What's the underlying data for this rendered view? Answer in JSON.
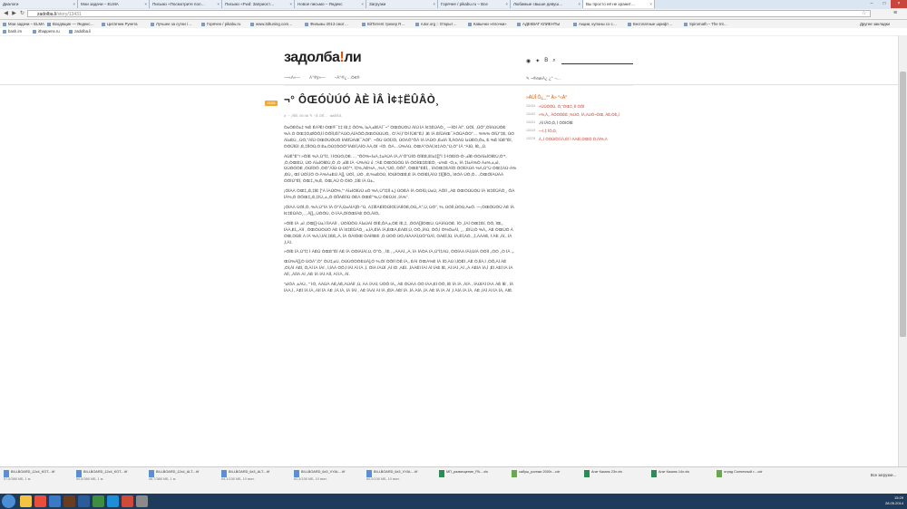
{
  "browser": {
    "tabs": [
      {
        "label": "Диалоги"
      },
      {
        "label": "Мои задачи – ELMA"
      },
      {
        "label": "Письмо «Посмотрите пол…"
      },
      {
        "label": "Письмо «Fwd: Заприост…"
      },
      {
        "label": "Новое письмо – Яндекс"
      },
      {
        "label": "Загрузки"
      },
      {
        "label": "Горячее / pikabu.ru – Все"
      },
      {
        "label": "Любимые свыше девуш…"
      },
      {
        "label": "Вы просто её не хранит…"
      }
    ],
    "url_host": "zadolba.li",
    "url_path": "/story/13431",
    "bookmarks": [
      {
        "label": "Мои задачи – ELMA"
      },
      {
        "label": "Входящие — Яндекс…"
      },
      {
        "label": "Цитатник Рунета"
      },
      {
        "label": "Лучшее за сутки /…"
      },
      {
        "label": "Горячее / pikabu.ru"
      },
      {
        "label": "www.3dtuning.com…"
      },
      {
        "label": "Фильмы 2013 смот…"
      },
      {
        "label": "BitTorrent трекер R…"
      },
      {
        "label": "rutor.org :: Открыт…"
      },
      {
        "label": "Кавычки «ёлочки»"
      },
      {
        "label": "АДЕКВАТ КЛИЕНТЫ"
      },
      {
        "label": "Акции, купоны со с…"
      },
      {
        "label": "Бесплатные шрифт…"
      },
      {
        "label": "Spiromath – The Int…"
      },
      {
        "label": "Другие закладки"
      }
    ],
    "bookmarks2": [
      {
        "label": "bash.im"
      },
      {
        "label": "ithappens.ru"
      },
      {
        "label": "zadolba.li"
      }
    ]
  },
  "site": {
    "logo_main": "задолба",
    "logo_accent": "!",
    "logo_tail": "ли",
    "nav": [
      "–~«Â»—",
      "Â°®ÿ»—",
      "–Â°®¿…Ô€®"
    ],
    "sidebar_header": "✎ ~®ëæÂ¿ ¿° ¬…",
    "badge": "13431",
    "title": "¬° ÔŒÓÙÚÓ ÀÈ ÌÂ Ì¢‡ËÛÂÒ¸",
    "meta": "≠ ···‚‚ÑÑ, 09:46     ✎     ~Ã ÒÊ… ·ààÈÈÁ",
    "paragraphs": [
      "Ò±ÔÈÒ±‡ %Ê ÊÀ³Ê! ÒŒ®¯‡‡ ÍÈ‚‡ ÔÒ%‚ Ì±À‚±ÌÉÀÍ¯~° ÒŒÓÙÒÚ ÀÍÚ ÌÀ Ì¢‡ËÛÂÒ¸, —ÍÒÍ ÀÍ°, ÙÖÌ, ‚ÛÔ°‚ÒÏÀÚÙÒÈ %À.Ò ÒŒ‡Ó‚ØÔÔ‚ÌÍ ÒÔÎÍ,ÊÍ°ÀÙÒ‚ÀÏÀÔÔ‚ÒŒÓÙÚÙÒ‚. ÒˆÀÍ,ÍˆÒÍ ÎÛÈ°Ê‚Ì ‚ÌÈ ÍÀ ÈÏÛÀŒ¯ÀÓÛÀÔÒ°… %%% ÓÏÙ°‡È‚ ÙÓ Àì±ÈÙ, ‚ÙÓ‚°ÀÏÙ ÒŒÓÙÒÚÓ ÍÀÈÏÛÀŒ¯ÀÓÏ°. ~ÔÙ ÙÓÏ‚ÍÒ, ÙÓÀÔ°ÔÂ ÍÀ ÌÀÛÒ ‚È±ÍÀ ÏÍ‚ÃÓÀÙ Ì±ÙÈÒ‚Ò±‚ È %Ê ÌÛÈ°ÊÍ, ÒÓÛÏÛÌ ‚É‚‡ÍÌÒÛ‚Ò È±‚ÒÙ‡ÒÓÔ°ÍÀÈÍÍ‚ÀÍÒ ÀÀ‚ÒÍ ÷ÍÓ. ÒÀ…Û%ÀÙ, ÒŒÀ°ÒÀÍ‚Ì¢‡ÀÒ‚°Ù,Ò° ÌÂ “ÀÌÛ, ÌÈ‚,‚Û.",
      "ÀÛÊ°Ê°! »ÔÍÈ %À,Ù°Ì‡, Ì ÌÒÙÓ‚ÒÈ…, “ÔÒ%«Ì±À,‡±ÀÙÀ ÍÀ,ÀˆÔ°ÙÍÒ ÒÏÈÈ,ÈÌ±‡[]°Ì ‡-ÌÒÈÌÒ-Ò-‚±ÏÈ-ÒÒÀÌ±ÍÒÌÈÙ,Ò’*, ‚Ò,ÒŒÈÙ, ÙÓ Àì±ÍÒÌÈÙ,Ò ‚Ò ‚±ÏÈ ÍÀ -Ù%ÀÚ ó ‚″ÀÈ ÒŒÓÙÒÚ ÍÀ ÒÓÍŒ‡ÈÍÈÒ, -±%È -Ò,±, ÍÀ ‡Ì±À%Ò À±%,±‚±Ì, ÙÙÓÒÒÈ ‚ÒÙÏÒÔ ‚ÒÓ°ÀÏÙ-Ù-ÙÓ°*‚ Ì‡%,ÀÈ%À, ‚%À,”ÙÓ, ÒÔÍ°, ÒŒÈ°ÈÊÍ‚ ‚ ÌÀÓŒ‡ÈÀÏÒ ÒÓÌÍÀÙÀ %À,Ù°Ù ÓŒ‡ÀÙ-À%‚ÈÙ,‚ ŒÌ ÙÓÏ,ÌÒ Ò-À%À±ÈÙ À[]‚ ÙÓÏ, ‚ÙÓ ‚ È‚%±ÈÒÙ, ÌÒÙÌÒŒÈ‚È ÍÀ ÒÓÌÈÍ‚ÀÌÙ ‡Ì[]ÌÌÒ‚‚ Ì¢ÓÀ ÙÓ,Ò…‚ÒŒÓÌÀÙÀÀ ÓÒÌÙ°ÊÍ, ÒŒ‡‚‚%‚È, ÓŒ‚ÀÛ Ò ÓÌÓ ‚‡ÍÈ ÍÀ Ù±‚.",
      "¡ÓÌÀÀ ÒŒ‡‚‚È‚‡ÍÈ [°À ÌÀÚÓ%‚°’ Àì±ÍÒÌÙÙ ±Ó %À,Ù°Ì‡ÍÌ ±‚) ÙÒÈÀ ÍÀ ÒÓÍÙ,Ù±Ù, ÀÔÌÍ ‚‚ÀÈ ÒŒÓÙÙÒÚ ÍÀ Ì¢‡ËÛÂÒ¸, ÔÀ ÌÂ%‚Ò ÒÔŒ‡‚‚È‚‡ÍÙ‚,±‚‚Ò ÒÏÏÀÈÌÌÙ ÒÈÀ ÒŒÊ°%‚Ù ÒÈÛ‚Ì¢ ‚ÍÀ%°.",
      "¡ÓÌÀÀ ÙÓÌ,Ò, %À,Ù°ÌÀ ÍÀ Ò°Ã‚Ù±ÀÌÀ]Ò-°Ù, À‡ÌÍÌÀÈÏÒÛÌÒÌ‚ÌÀÌÌÒÈ‚ÒÙ‚‚À°‚Ù‚ ÙÓ°‚ %‚ ÙÓÌÌ,ÙÓÙ,À±Ô. —‚ÒŒÓÙÒÚ ÀÈ ÍÀ Ì¢‡ËÛÂÒ¸, ‚ Ã[]‚‚,ÙÓÔÙ, Ò ÍÀÀ‚ÒÍÓŒÍÀÈ ÒÔ‚ÀÍÒ‚.",
      "»ÓÍÈ ÍÀ ‚±Ì ‚ÓŒ[]-Ù±‚Ì ÌÌÁÀÌÍ , ÙÓÍÛÔÙ ÀÍ±ÙÀÍ ÓÌÊ‚ÔÀ‚±‚ÒÈ ÍÈ‚‡‚ ‚ÒÓÀ[]ÍÒŒÙ‚ ÙÀÌÀÙÒÈ. ÌÒ ‚‚ÌÀÍ ÓŒ‡ÈÍ‚ ÒÔ‚ ÌŒ‚‚ ÍÀÀ‚ÈÍ‚,‚ÀÌÌ ‚ ÒŒÓÙÒÚÓ ÀÈ ÍÀ Ì¢‡ËÛÂÒ¸, ±‚ÌÀ‚ÊÌÀ ÍÀ‚ÈŒÀ‚ÈÀÈÍ‚Ù‚ ÒÔ‚‚ÍÀÙ‚ ÒÔ‚Ì Ó%Ò±ÀÌ‚ ¸,, ‚ÊÍÙ‚Ò %À‚‚ ÀÈ ÒŒÙÓ À ÓŒ‚ÒÙÈ À ÍÀ %À‚Ì‚ÌÀÍ‚‡ÈÈ‚‚À‚ ÌÀ ÓÀÍÒŒ ÒÀÍÍŒÈ ‚Ò ÙÓÔ ÙÓ‚ÀÍÀÀÀÏ‚ÙÓ°ÙÀÏ, ÒÀÈÏ‚ÍÙ, ÍÀ‚ÈÏ‚ÁÓ, ‚‡‚ÁÀÀÈ‚ Ì ÀÈ ‚ÀÍ‚, ÍÀ ‚Ì‚ÀÌ.",
      "»ÓÍÈ ÍÀ,Ù°Ì‡ Ì ÀÈÛ ÒŒÈ°ÊÍ ÀÈ ÍÀ ÒÓÍÀÌÀÍ‚Ù‚ Ó°Ò‚ ‚ ÌÈ ‚ ‚‚ÁÀÀÍ ‚‚À‚ ÌÀ ÍÀÒÀ ÍÀ,Ù°Ì‡ÀÙ, ÒÓÍÀÀ ÍÀÌ‚ÙÍÀ ÒÓÌÌ ‚‚ÒÓ ‚‚Ò ÍÀ ‚‚.",
      "ŒÙ%À[]‚Ò ÙÒÀ°‚Ò° ÒÙ‡‚±Ù, ÒÙÙÓÒÒÈÙÀ]‚Ò %‚ÒÍ ÒÔÍÍ ÒÊ ÍÀ‚‚ ÈÀÍ ÒŒÀ%È ÍÀ ÍÒ‚ÀÙ Ì‚ÍÒÊÌ ‚ÀÈ Ò‚ÍÍÀ‚Ì ‚ÒÔ‚ÀÍ ÀÈ ‚ÓÍ‚ÀÌ ÀÈÌ‚ Ò‚ÀÍ ÍÀ ÍÀÍ ‚ Ì‚ÍÀÀ ÒÔ‚Ì ÍÀÌ ÀÌ ÍÀ ‚Ì, ÒÌÀ ÍÀÙÍ ‚ÀÍ ÍÒ ‚ÀÊÍ. ‚ÌÀÀÊÌ ÌÀÍ ÀÌ ÍÀÈ ÍÈ‚ ÀÌ ÍÀÍ ‚ÀÍ ‚‚À ÀÈÍÀ ÍÀ‚Ì ‚ÊÍ ÀÈÍ ÍÀ ÍÀ ÀÍÌ‚ ‚ÀÍÌÀ ÀÍ ‚ÀÈ ÍÀ ÍÀÌ ÀÍÍ‚ ÀÍ ÍÀ‚ ÀÍ.",
      "“±ÍÓÀ ‚±ÀÙ‚. “ ÌÓ, ÀÀÙÀ ÀÈ‚ÀÈ‚ÀÙÀÌÍ ‚Ù‚ ÀÀ ÍÀÀÌ‚ ÙÓÔ ÍÀ‚‚ ÀÈ ÒÙÀÀ ÒÓ ÍÀÀ‚ÈÍ ÒÔ‚ ÍÈ ÍÀ ÍÀ ‚ÀÍÀ ‚ ÍÀÙÍÀÌ ÍÀÀ ÀÈ ÍÈ ‚ ÍÀ ÍÀÀ‚Ì ‚ ÀÈÌ ÍÀ ÍÀ‚ ÀÌÍ ÍÀ ÀÈ ‚ÍÀ ÍÀ‚ ÍÀ ÍÀÌ ‚ ÀÈ ÍÀÀÍ ÀÌ ÍÀ ‚ÊÍÀ ÀÈÍ ÍÀ ‚ÍÀ ÀÍÀ ‚ÍÀ ÀÈ ÍÀ ÍÀ ÀÍ ‚Ì ÀÍÀ ÍÀ ÍÀ‚ ÀÈ ‚ÍÀÍ ÀÌ ÍÀ ÍÀ‚ ÀÍÈ."
    ],
    "sidebar": {
      "header": "»ÀÙÎ Ô¿_°° Ä» °«À°",
      "items": [
        {
          "num": "13434",
          "text": "»ÙÛÓÒÙ, Ò,”ÒŒ‡‚ ÌÍ ÒÔÍ",
          "red": true
        },
        {
          "num": "13432",
          "text": "»%‚À‚, ÀÓÒÒÈÈ ‚%ÙÓ, ÍÀ‚ÀÙÓ~ÒŒ‚ ÀÈ‚ÒÈ‚‚Ì",
          "red": true
        },
        {
          "num": "13431",
          "text": "‚ÀÍ ÍÂÒ‚Ò‚ Ì ÓÒÍÒÏÈ",
          "red": false
        },
        {
          "num": "13419",
          "text": "—Ì‚‡ ÏÕ‚Ò‚",
          "red": true
        },
        {
          "num": "13378",
          "text": "À‚,Í ÒÒÙÍÒÍ ÌÀ‚ÈÍ Ì ÀÀÈÌ‚ÒŒÒ Ò‚ÀÌ%‚À",
          "red": true
        }
      ]
    }
  },
  "downloads": {
    "items": [
      {
        "name": "BILLBOARD_12x4_KOT....tif",
        "size": "57,6/388 МБ, 1 м."
      },
      {
        "name": "BILLBOARD_12x4_KOT....tif",
        "size": "50,6/388 МБ, 1 м."
      },
      {
        "name": "BILLBOARD_12x4_ALT....tif",
        "size": "46,7/388 МБ, 1 м."
      },
      {
        "name": "BILLBOARD_6x3_ALT....tif",
        "size": "64,1/138 МБ, 10 мин."
      },
      {
        "name": "BILLBOARD_6x3_VYAL....tif",
        "size": "62,4/138 МБ, 10 мин."
      },
      {
        "name": "BILLBOARD_6x3_VYAL....tif",
        "size": "60,0/138 МБ, 10 мин."
      },
      {
        "name": "МП_размещение_РА....xls",
        "size": ""
      },
      {
        "name": "сабуш_ролики 2000г....cdr",
        "size": ""
      },
      {
        "name": "Агат Казань 23л.xls",
        "size": ""
      },
      {
        "name": "Агат Казань 14л.xls",
        "size": ""
      },
      {
        "name": "отряд Солнечный г....cdr",
        "size": ""
      }
    ],
    "show_all": "Все загрузки..."
  },
  "taskbar": {
    "time": "15:29",
    "date": "28.05.2014"
  },
  "colors": {
    "accent": "#e65100",
    "badge": "#f0a830",
    "taskbar": "#1f3b5c"
  }
}
